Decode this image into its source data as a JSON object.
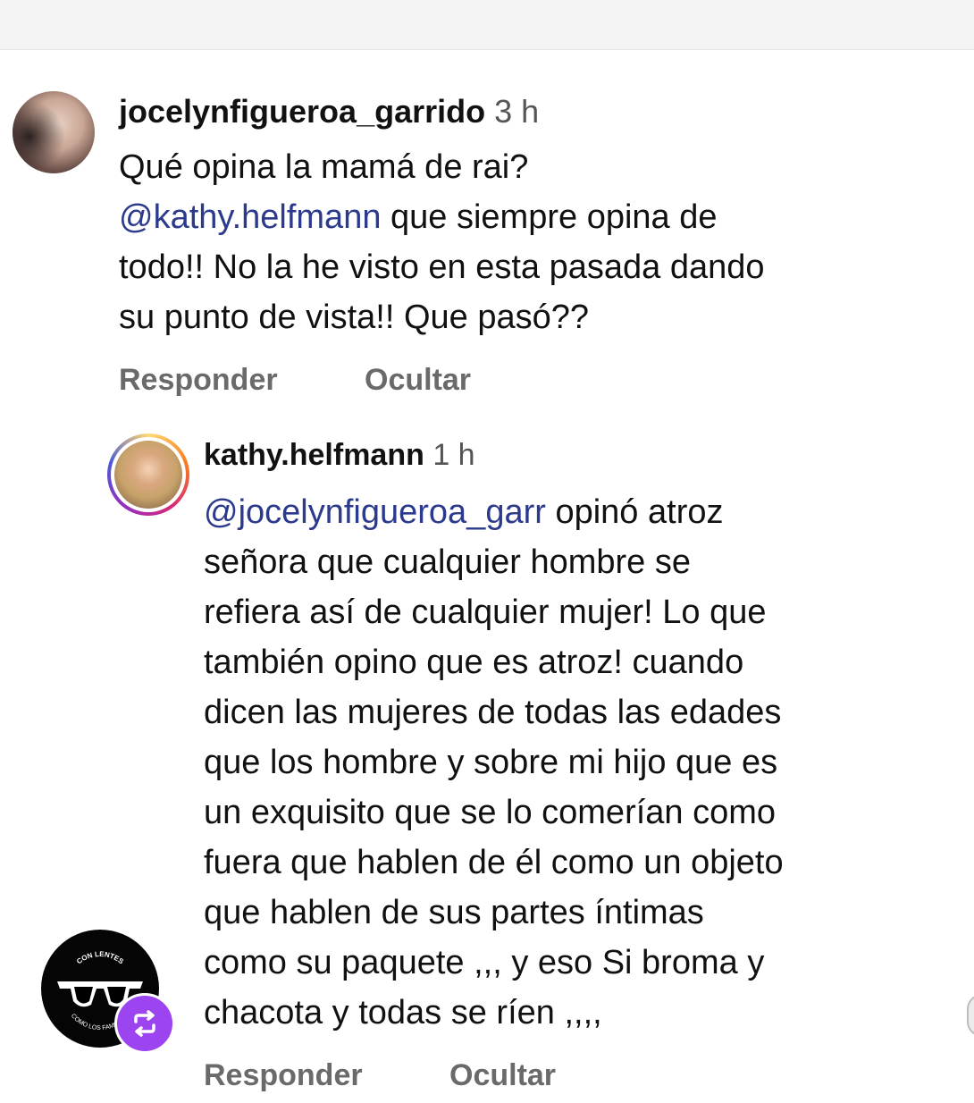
{
  "comment1": {
    "username": "jocelynfigueroa_garrido",
    "time": "3 h",
    "lines": [
      {
        "text": "Qué opina la mamá de rai?"
      },
      {
        "mention": "@kathy.helfmann",
        "text": "  que siempre opina de"
      },
      {
        "text": "todo!! No la he visto en esta pasada dando"
      },
      {
        "text": "su punto de vista!! Que pasó??"
      }
    ],
    "reply_label": "Responder",
    "hide_label": "Ocultar"
  },
  "comment2": {
    "username": "kathy.helfmann",
    "time": "1 h",
    "lines": [
      {
        "mention": "@jocelynfigueroa_garr",
        "text": " opinó atroz"
      },
      {
        "text": "señora que cualquier hombre se"
      },
      {
        "text": "refiera así de cualquier mujer! Lo que"
      },
      {
        "text": "también opino que es atroz!  cuando"
      },
      {
        "text": "dicen las mujeres de todas las edades"
      },
      {
        "text": "que los hombre y sobre mi hijo que es"
      },
      {
        "text": "un exquisito que se lo comerían como"
      },
      {
        "text": "fuera que hablen de él como un objeto"
      },
      {
        "text": "que hablen de sus partes íntimas"
      },
      {
        "text": "como su paquete ,,, y eso Si  broma y"
      },
      {
        "text": "chacota y todas se ríen ,,,,"
      }
    ],
    "reply_label": "Responder",
    "hide_label": "Ocultar"
  },
  "badge": {
    "top_text": "CON LENTES",
    "bottom_text": "COMO LOS FAMOSOS"
  },
  "colors": {
    "mention": "#2b3a8c",
    "action": "#6a6a6a",
    "repost": "#9b44f0"
  }
}
